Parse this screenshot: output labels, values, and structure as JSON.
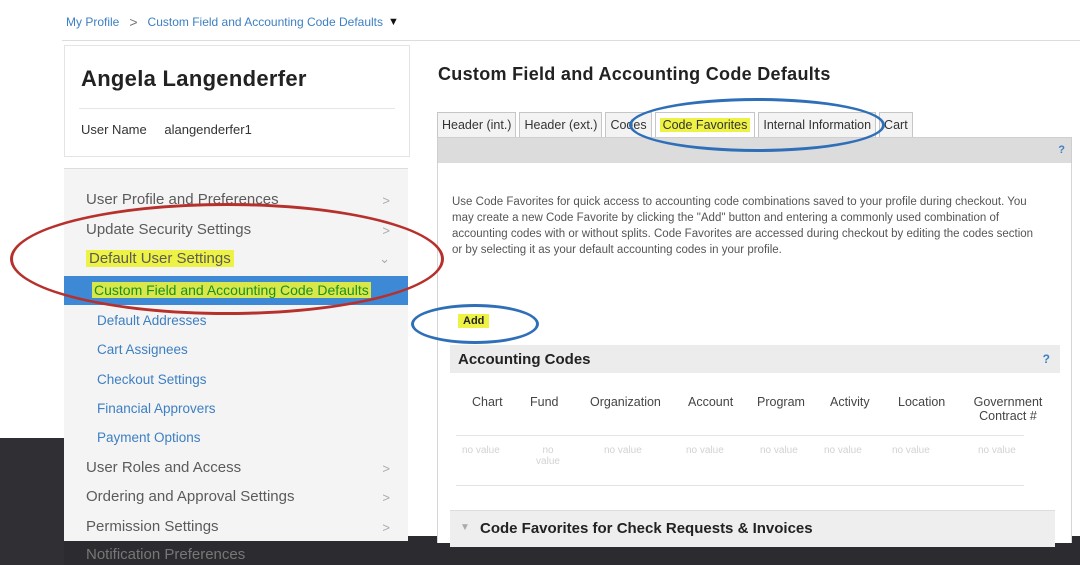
{
  "breadcrumb": {
    "root": "My Profile",
    "separator": ">",
    "current": "Custom Field and Accounting Code Defaults"
  },
  "user": {
    "display_name": "Angela Langenderfer",
    "username_label": "User Name",
    "username": "alangenderfer1"
  },
  "sidebar": {
    "items": [
      {
        "label": "User Profile and Preferences"
      },
      {
        "label": "Update Security Settings"
      },
      {
        "label": "Default User Settings"
      },
      {
        "label": "User Roles and Access"
      },
      {
        "label": "Ordering and Approval Settings"
      },
      {
        "label": "Permission Settings"
      },
      {
        "label": "Notification Preferences"
      }
    ],
    "subitems": [
      {
        "label": "Custom Field and Accounting Code Defaults"
      },
      {
        "label": "Default Addresses"
      },
      {
        "label": "Cart Assignees"
      },
      {
        "label": "Checkout Settings"
      },
      {
        "label": "Financial Approvers"
      },
      {
        "label": "Payment Options"
      }
    ]
  },
  "main": {
    "title": "Custom Field and Accounting Code Defaults",
    "tabs": [
      {
        "label": "Header (int.)"
      },
      {
        "label": "Header (ext.)"
      },
      {
        "label": "Codes"
      },
      {
        "label": "Code Favorites"
      },
      {
        "label": "Internal Information"
      },
      {
        "label": "Cart"
      }
    ],
    "help": "?",
    "description": "Use Code Favorites for quick access to accounting code combinations saved to your profile during checkout. You may create a new Code Favorite by clicking the \"Add\" button and entering a commonly used combination of accounting codes with or without splits. Code Favorites are accessed during checkout by editing the codes section or by selecting it as your default accounting codes in your profile.",
    "add_button": "Add",
    "accounting_codes": {
      "title": "Accounting Codes",
      "columns": [
        "Chart",
        "Fund",
        "Organization",
        "Account",
        "Program",
        "Activity",
        "Location",
        "Government Contract #"
      ],
      "values": [
        "no value",
        "no value",
        "no value",
        "no value",
        "no value",
        "no value",
        "no value",
        "no value"
      ]
    },
    "favorites_section": "Code Favorites for Check Requests & Invoices"
  },
  "colors": {
    "active_nav": "#3d89d6",
    "highlight": "#eef244",
    "annotation_red": "#b7312c",
    "annotation_blue": "#2f6fb8",
    "link": "#3d7fc2"
  }
}
